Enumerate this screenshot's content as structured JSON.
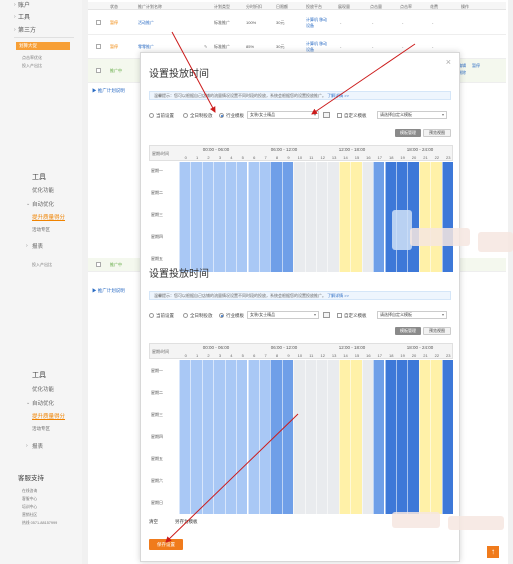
{
  "sidebar": {
    "top_items": [
      {
        "label": "账户"
      },
      {
        "label": "工具"
      },
      {
        "label": "第三方"
      }
    ],
    "active_item": "划算大促",
    "small_items": [
      "点击率优化",
      "投入产出比"
    ],
    "tools_menu_1": {
      "heading": "工具",
      "items": [
        "优化功能",
        "自动优化",
        "提升质量得分",
        "活动专区",
        "报表"
      ],
      "footer": "投入产出比"
    },
    "tools_menu_2": {
      "heading": "工具",
      "items": [
        "优化功能",
        "自动优化",
        "提升质量得分",
        "活动专区",
        "报表"
      ]
    },
    "help": {
      "heading": "客服支持",
      "items": [
        "在线咨询",
        "客服中心",
        "培训中心",
        "营销社区",
        "热线 0571-88157999"
      ]
    }
  },
  "table": {
    "headers": [
      "状态",
      "推广计划名称",
      "计划类型",
      "分时折扣",
      "日限额",
      "投放平台",
      "展现量",
      "点击量",
      "点击率",
      "花费",
      "操作"
    ],
    "rows": [
      {
        "status": "暂停",
        "name": "活动推广",
        "type": "标准推广",
        "discount": "100%",
        "budget": "30元",
        "platform": "计算机 移动设备",
        "impr": "-",
        "clicks": "-",
        "ctr": "-",
        "cost": "-"
      },
      {
        "status": "暂停",
        "name": "零零推广",
        "type": "标准推广",
        "discount": "85%",
        "budget": "30元",
        "platform": "计算机 移动设备",
        "impr": "-",
        "clicks": "-",
        "ctr": "-",
        "cost": "-"
      },
      {
        "status": "推广中",
        "name": "",
        "type": "",
        "discount": "",
        "budget": "",
        "platform": "",
        "impr": "",
        "clicks": "",
        "ctr": "",
        "cost": "",
        "ops": [
          "编辑",
          "暂停",
          "删除"
        ]
      }
    ],
    "plan_link": "推广计划说明",
    "row_extra_status": "推广中"
  },
  "dialog": {
    "title": "设置投放时间",
    "title_2": "设置投放时间",
    "close": "×",
    "note": "温馨提示：您可以根据自己店铺的流量情况设置不同时段的投放，系统会根据您的设置投放推广。",
    "note_link": "了解详情 >>",
    "options": {
      "current": "当前设置",
      "all_day": "全日制投放",
      "industry": "行业模板",
      "industry_value": "女装/女士精品",
      "custom": "自定义模板",
      "custom_value": "请选择自定义模板"
    },
    "buttons": {
      "template": "模板管理",
      "preview": "预览视图"
    },
    "grid": {
      "corner": "星期/时间",
      "periods": [
        "00:00 - 06:00",
        "06:00 - 12:00",
        "12:00 - 18:00",
        "18:00 - 24:00"
      ],
      "hours": [
        "0",
        "1",
        "2",
        "3",
        "4",
        "5",
        "6",
        "7",
        "8",
        "9",
        "10",
        "11",
        "12",
        "13",
        "14",
        "15",
        "16",
        "17",
        "18",
        "19",
        "20",
        "21",
        "22",
        "23"
      ],
      "days_1": [
        "星期一",
        "星期二",
        "星期三",
        "星期四",
        "星期五"
      ],
      "days_2": [
        "星期一",
        "星期二",
        "星期三",
        "星期四",
        "星期五",
        "星期六",
        "星期日"
      ],
      "hour_levels": [
        "light",
        "light",
        "light",
        "light",
        "light",
        "light",
        "light",
        "light",
        "medium",
        "medium",
        "gray",
        "gray",
        "gray",
        "gray",
        "yellow",
        "yellow",
        "gray",
        "medium",
        "dark",
        "dark",
        "dark",
        "yellow",
        "yellow",
        "dark"
      ]
    },
    "footer": {
      "clear": "清空",
      "save_template": "另存为模板"
    },
    "save_button": "保存设置",
    "colors": {
      "light": "#a9c8f5",
      "medium": "#6f9fe8",
      "dark": "#3d78d8",
      "gray": "#e9ebee",
      "yellow": "#fff1a8"
    }
  },
  "totop": "↑"
}
